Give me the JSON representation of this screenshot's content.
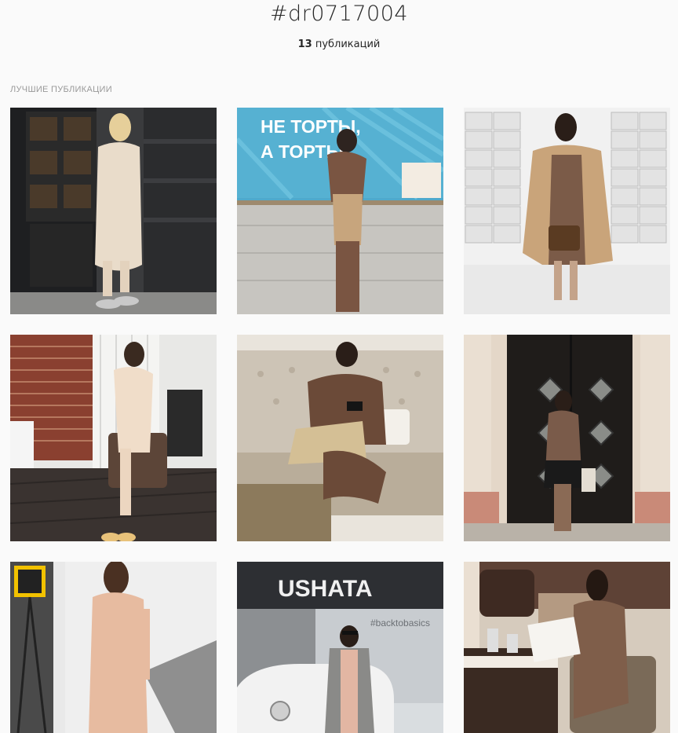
{
  "hashtag": {
    "title": "#dr0717004"
  },
  "stats": {
    "count": "13",
    "label": " публикаций"
  },
  "section": {
    "label": "ЛУЧШИЕ ПУБЛИКАЦИИ"
  },
  "posts": [
    {
      "name": "post-blonde-cream-dress-black-door"
    },
    {
      "name": "post-cafe-counter-brown-outfit",
      "sign_line1": "НЕ ТОРТЫ,",
      "sign_line2": "А ТОРТЫ"
    },
    {
      "name": "post-mailboxes-camel-coat"
    },
    {
      "name": "post-brick-wall-cream-dress"
    },
    {
      "name": "post-sofa-brown-dress-phone"
    },
    {
      "name": "post-black-door-brown-dress"
    },
    {
      "name": "post-studio-pink-dress"
    },
    {
      "name": "post-street-car-grey-coat",
      "sign": "USHATA",
      "wall_text": "#backtobasics"
    },
    {
      "name": "post-restaurant-menu-brown-dress"
    }
  ]
}
